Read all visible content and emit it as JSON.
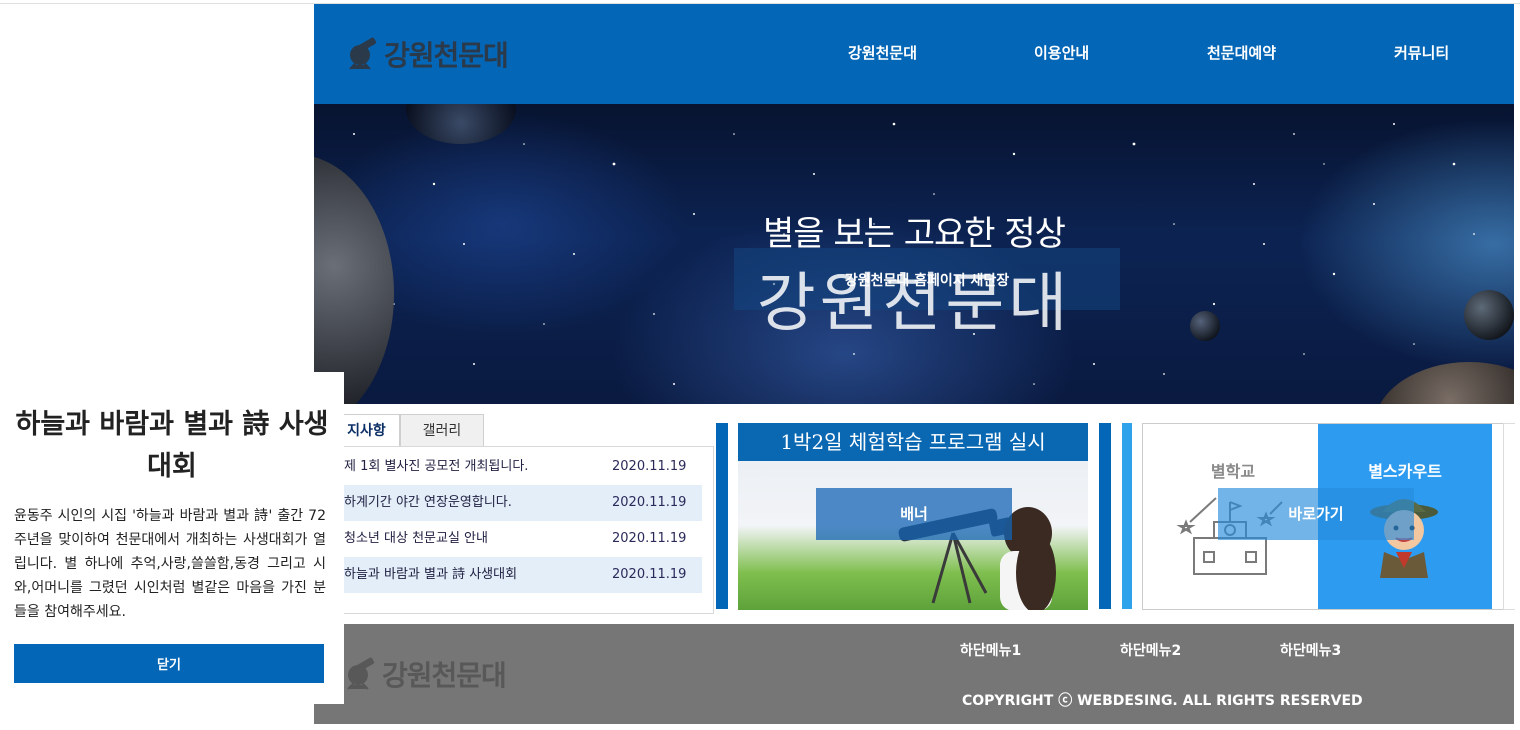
{
  "header": {
    "logo_text": "강원천문대",
    "nav": [
      "강원천문대",
      "이용안내",
      "천문대예약",
      "커뮤니티"
    ]
  },
  "hero": {
    "subtitle": "별을 보는 고요한 정상",
    "title": "강원천문대",
    "banner_text": "강원천문대 홈페이지 새단장"
  },
  "notice": {
    "tabs": [
      "지사항",
      "갤러리"
    ],
    "items": [
      {
        "title": "제 1회 별사진 공모전 개최됩니다.",
        "date": "2020.11.19"
      },
      {
        "title": "하계기간 야간 연장운영합니다.",
        "date": "2020.11.19"
      },
      {
        "title": "청소년 대상 천문교실 안내",
        "date": "2020.11.19"
      },
      {
        "title": "하늘과 바람과 별과 詩 사생대회",
        "date": "2020.11.19"
      }
    ]
  },
  "banner": {
    "title": "1박2일 체험학습 프로그램 실시",
    "overlay": "배너"
  },
  "links": {
    "left_label": "별학교",
    "right_label": "별스카우트",
    "go_label": "바로가기"
  },
  "footer": {
    "logo_text": "강원천문대",
    "menu": [
      "하단메뉴1",
      "하단메뉴2",
      "하단메뉴3"
    ],
    "copyright": "COPYRIGHT ⓒ WEBDESING. ALL RIGHTS RESERVED"
  },
  "popup": {
    "title": "하늘과 바람과 별과 詩 사생대회",
    "body": "윤동주 시인의 시집 '하늘과 바람과 별과 詩' 출간 72주년을 맞이하여 천문대에서 개최하는 사생대회가 열립니다. 별 하나에 추억,사랑,쓸쓸함,동경 그리고 시와,어머니를 그렸던 시인처럼 별같은 마음을 가진 분들을 참여해주세요.",
    "close_label": "닫기"
  },
  "colors": {
    "primary": "#0466b6",
    "accent": "#2d9cf0",
    "footer": "#767676"
  }
}
